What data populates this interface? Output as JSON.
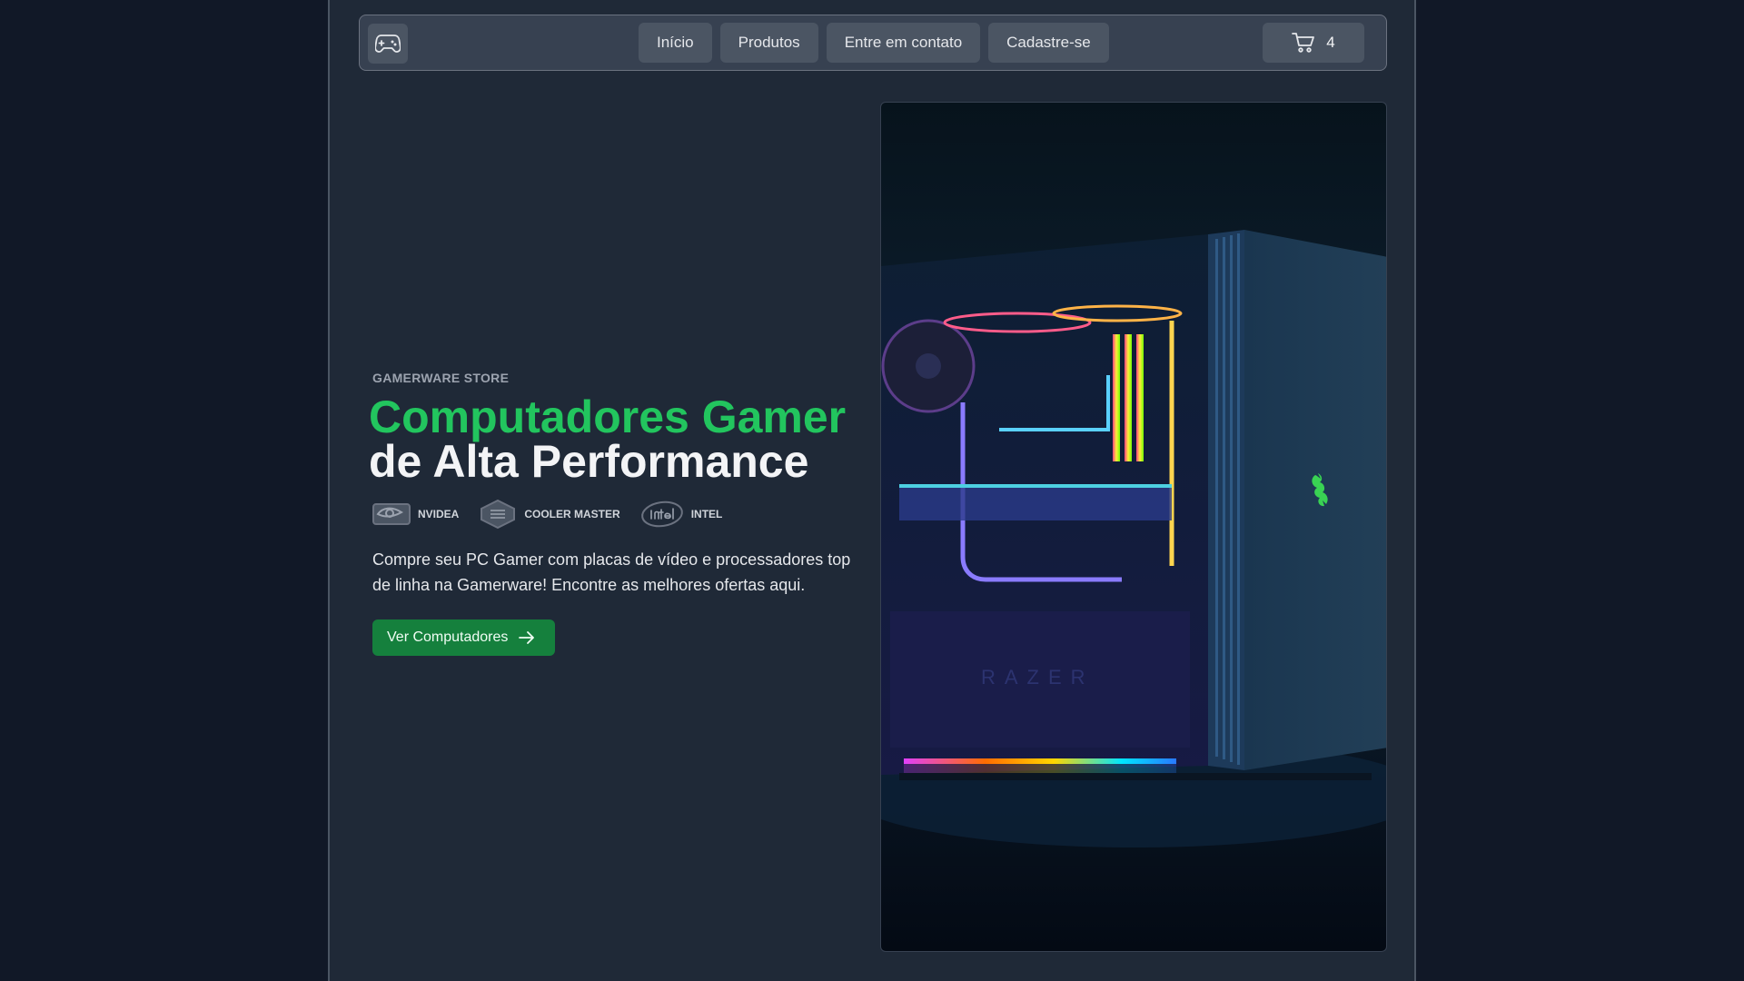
{
  "nav": {
    "logo_icon": "gamepad-icon",
    "links": [
      "Início",
      "Produtos",
      "Entre em contato",
      "Cadastre-se"
    ],
    "cart_icon": "cart-icon",
    "cart_count": "4"
  },
  "hero": {
    "eyebrow": "GAMERWARE STORE",
    "title_line1": "Computadores Gamer",
    "title_line2": "de Alta Performance",
    "brands": [
      {
        "icon": "nvidia-logo-icon",
        "name": "NVIDEA"
      },
      {
        "icon": "cooler-master-logo-icon",
        "name": "COOLER MASTER"
      },
      {
        "icon": "intel-logo-icon",
        "name": "INTEL"
      }
    ],
    "description": "Compre seu PC Gamer com placas de vídeo e processadores top de linha na Gamerware! Encontre as melhores ofertas aqui.",
    "cta_label": "Ver Computadores",
    "cta_icon": "arrow-right-icon",
    "image_logo_text": "RAZER"
  },
  "colors": {
    "accent_green": "#22c55e",
    "button_green": "#15803d",
    "page_bg": "#1f2937",
    "outer_bg": "#111827",
    "nav_bg": "#374151"
  }
}
